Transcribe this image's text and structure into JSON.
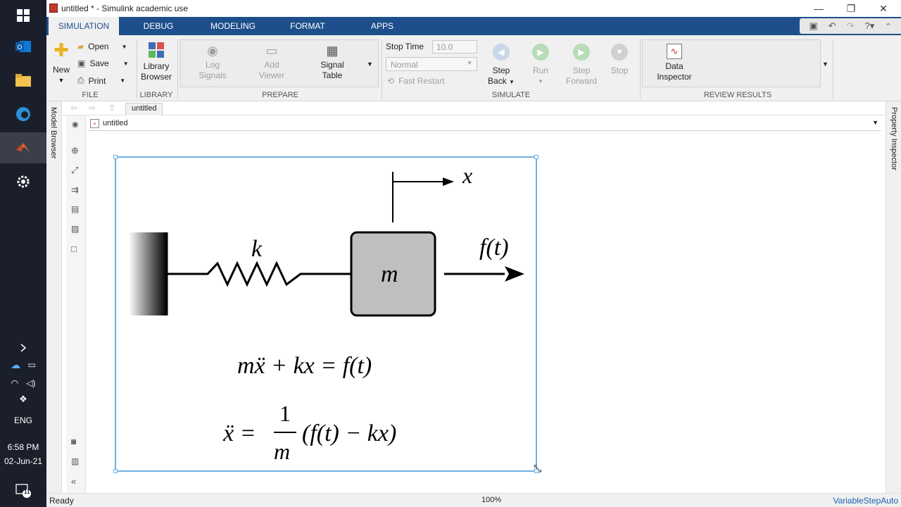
{
  "taskbar": {
    "lang": "ENG",
    "time": "6:58 PM",
    "date": "02-Jun-21",
    "notif_count": "11"
  },
  "window": {
    "title": "untitled * - Simulink academic use"
  },
  "tabs": [
    "SIMULATION",
    "DEBUG",
    "MODELING",
    "FORMAT",
    "APPS"
  ],
  "ribbon": {
    "file": {
      "new": "New",
      "open": "Open",
      "save": "Save",
      "print": "Print",
      "label": "FILE"
    },
    "library": {
      "browser_line1": "Library",
      "browser_line2": "Browser",
      "label": "LIBRARY"
    },
    "prepare": {
      "log1": "Log",
      "log2": "Signals",
      "add1": "Add",
      "add2": "Viewer",
      "sig1": "Signal",
      "sig2": "Table",
      "label": "PREPARE"
    },
    "simulate": {
      "stop_time_label": "Stop Time",
      "stop_time_value": "10.0",
      "mode": "Normal",
      "fast_restart": "Fast Restart",
      "stepback1": "Step",
      "stepback2": "Back",
      "run": "Run",
      "stepfwd1": "Step",
      "stepfwd2": "Forward",
      "stop": "Stop",
      "label": "SIMULATE"
    },
    "review": {
      "di1": "Data",
      "di2": "Inspector",
      "label": "REVIEW RESULTS"
    }
  },
  "nav": {
    "crumb": "untitled"
  },
  "address": {
    "path": "untitled"
  },
  "side": {
    "model_browser": "Model Browser",
    "property_inspector": "Property Inspector"
  },
  "diagram": {
    "x_label": "x",
    "k_label": "k",
    "m_label": "m",
    "f_label": "f(t)",
    "eq1": "mẍ + kx = f(t)",
    "eq2_lhs": "ẍ =",
    "eq2_num": "1",
    "eq2_den": "m",
    "eq2_rhs": "(f(t) − kx)"
  },
  "status": {
    "left": "Ready",
    "zoom": "100%",
    "solver": "VariableStepAuto"
  },
  "colors": {
    "ribbon_tab": "#1e4f8c",
    "selection": "#6fb0e0",
    "run_green": "#7cc47c"
  }
}
